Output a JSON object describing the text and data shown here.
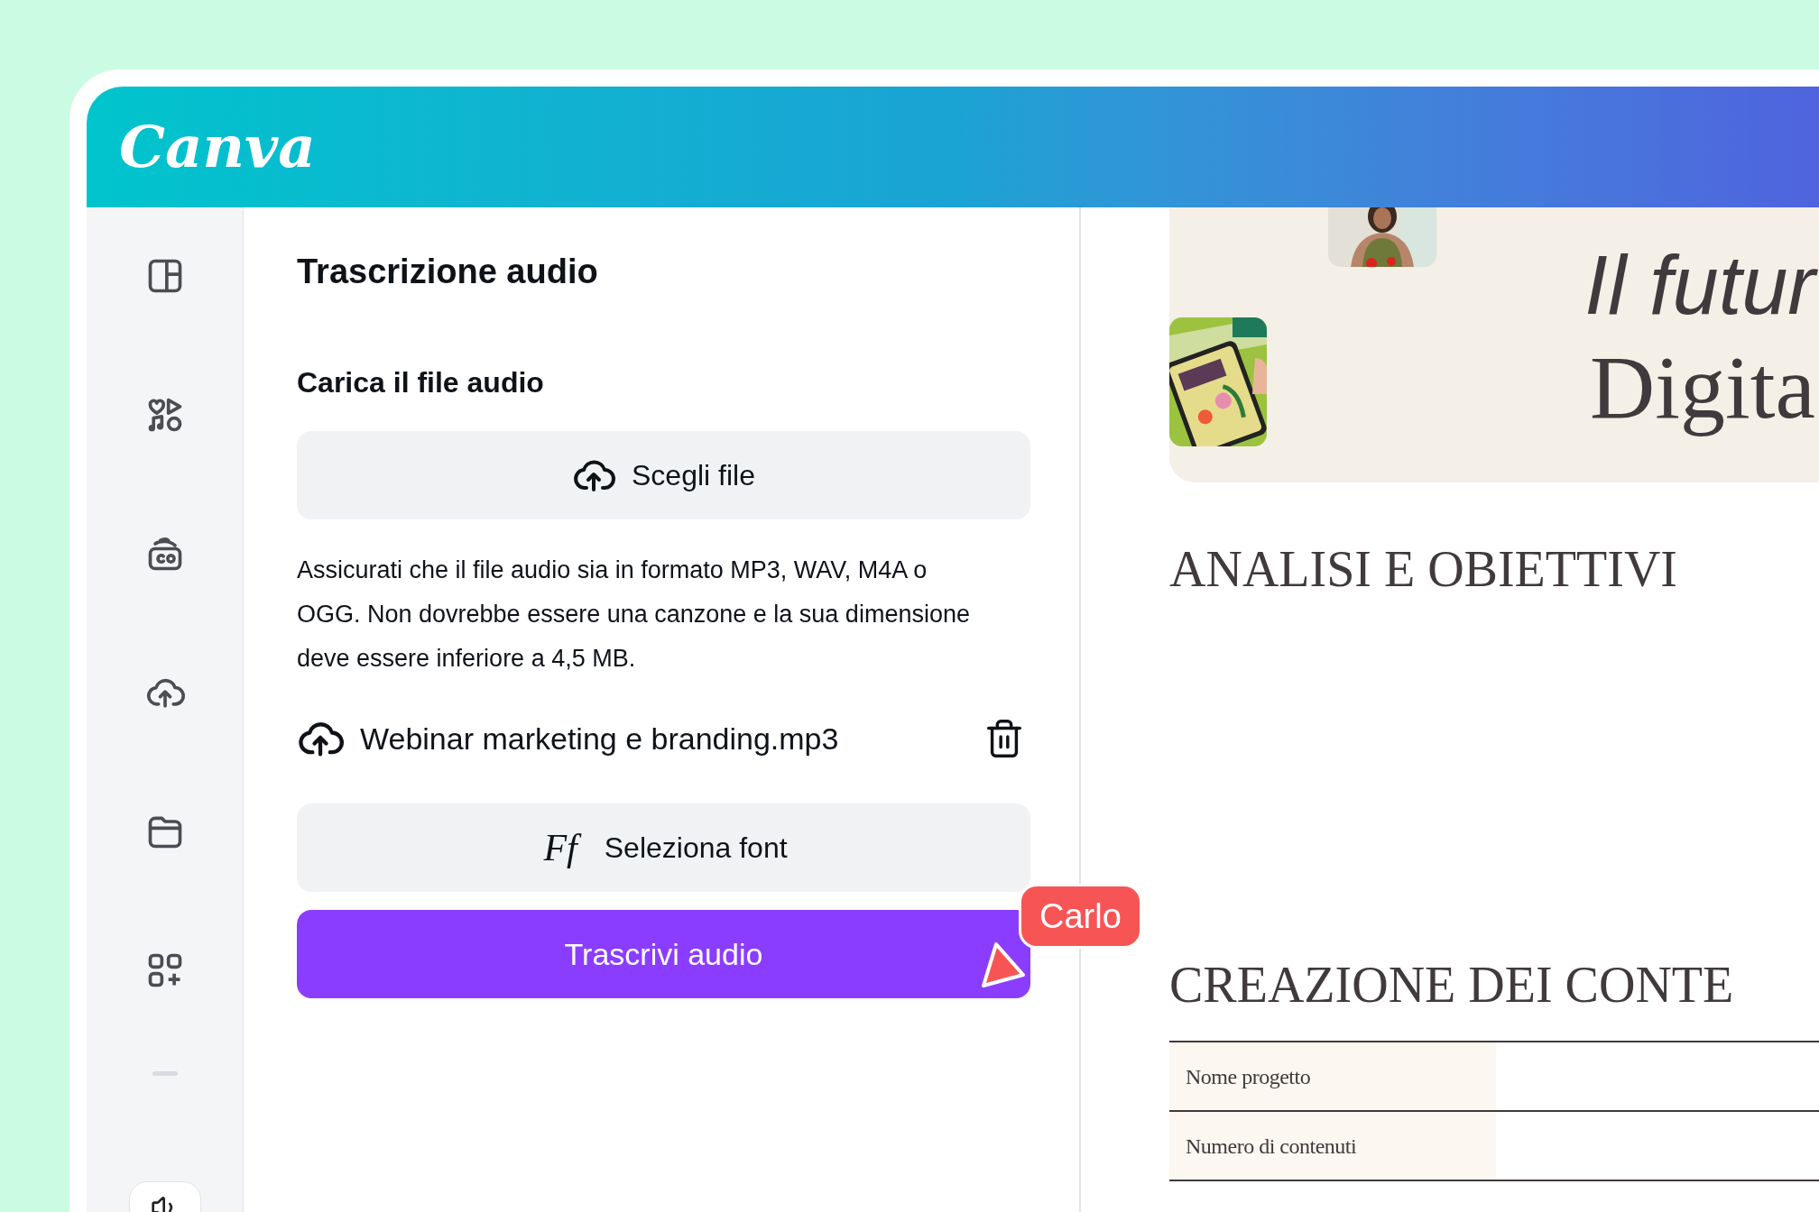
{
  "header": {
    "logo": "Canva"
  },
  "panel": {
    "title": "Trascrizione audio",
    "section_title": "Carica il file audio",
    "choose_button": "Scegli file",
    "note": "Assicurati che il file audio sia in formato MP3, WAV, M4A o OGG. Non dovrebbe essere una canzone e la sua dimensione deve essere inferiore a 4,5 MB.",
    "file": {
      "name": "Webinar marketing e branding.mp3"
    },
    "font_button": {
      "icon_text": "Ff",
      "label": "Seleziona font"
    },
    "submit_button": "Trascrivi audio"
  },
  "cursor": {
    "name": "Carlo"
  },
  "canvas": {
    "title_lines": [
      {
        "text": "Il futur",
        "italic": true
      },
      {
        "text": "Digita",
        "italic": false
      }
    ],
    "headings": [
      "ANALISI E OBIETTIVI",
      "CREAZIONE DEI CONTE"
    ],
    "table": {
      "rows": [
        {
          "label": "Nome progetto"
        },
        {
          "label": "Numero di contenuti"
        }
      ]
    }
  }
}
